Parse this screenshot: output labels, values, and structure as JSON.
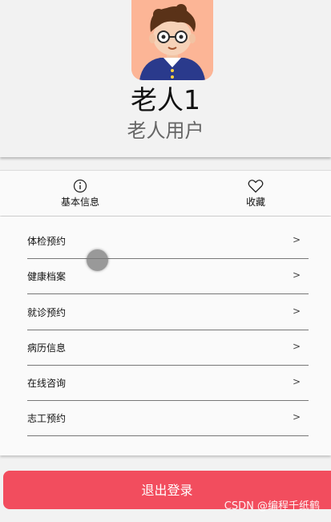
{
  "profile": {
    "name": "老人1",
    "role": "老人用户"
  },
  "actions": [
    {
      "label": "基本信息",
      "icon": "info-icon"
    },
    {
      "label": "收藏",
      "icon": "heart-icon"
    }
  ],
  "menu": [
    {
      "label": "体检预约",
      "chevron": ">"
    },
    {
      "label": "健康档案",
      "chevron": ">"
    },
    {
      "label": "就诊预约",
      "chevron": ">"
    },
    {
      "label": "病历信息",
      "chevron": ">"
    },
    {
      "label": "在线咨询",
      "chevron": ">"
    },
    {
      "label": "志工预约",
      "chevron": ">"
    }
  ],
  "logout_label": "退出登录",
  "watermark": "CSDN @编程千纸鹤",
  "colors": {
    "accent": "#f24d5e",
    "background": "#f2f2f2",
    "avatar_bg": "#fcb596"
  }
}
